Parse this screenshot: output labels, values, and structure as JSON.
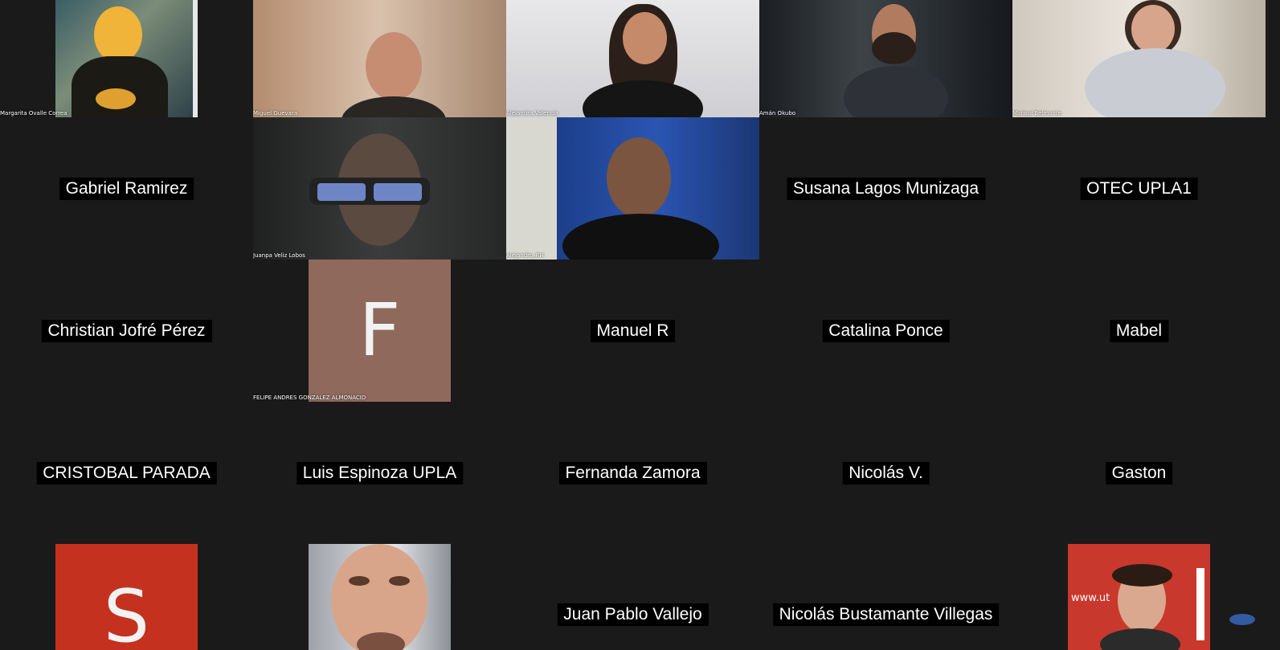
{
  "participants": [
    {
      "name": "Margarita Ovalle Correa",
      "kind": "video"
    },
    {
      "name": "Miguel Guevara",
      "kind": "video"
    },
    {
      "name": "Alejandra.Valencia",
      "kind": "video"
    },
    {
      "name": "Amán Okubo",
      "kind": "video"
    },
    {
      "name": "Marisol Belmonte",
      "kind": "video"
    },
    {
      "name": "Gabriel Ramirez",
      "kind": "name"
    },
    {
      "name": "Juanpa Veliz Lobos",
      "kind": "video"
    },
    {
      "name": "Alejandro_RH",
      "kind": "video"
    },
    {
      "name": "Susana Lagos Munizaga",
      "kind": "name"
    },
    {
      "name": "OTEC UPLA1",
      "kind": "name"
    },
    {
      "name": "Christian Jofré Pérez",
      "kind": "name"
    },
    {
      "name": "FELIPE ANDRES GONZALEZ ALMONACID",
      "kind": "avatar",
      "initial": "F",
      "color": "#8f6a5c"
    },
    {
      "name": "Manuel R",
      "kind": "name"
    },
    {
      "name": "Catalina Ponce",
      "kind": "name"
    },
    {
      "name": "Mabel",
      "kind": "name"
    },
    {
      "name": "CRISTOBAL PARADA",
      "kind": "name"
    },
    {
      "name": "Luis Espinoza UPLA",
      "kind": "name"
    },
    {
      "name": "Fernanda Zamora",
      "kind": "name"
    },
    {
      "name": "Nicolás V.",
      "kind": "name"
    },
    {
      "name": "Gaston",
      "kind": "name"
    },
    {
      "name": "",
      "kind": "avatar",
      "initial": "S",
      "color": "#c4321f"
    },
    {
      "name": "",
      "kind": "video"
    },
    {
      "name": "Juan Pablo Vallejo",
      "kind": "name"
    },
    {
      "name": "Nicolás Bustamante Villegas",
      "kind": "name"
    },
    {
      "name": "",
      "kind": "video"
    }
  ],
  "partial_text": {
    "tile_13_logo_text": "www.ut"
  }
}
